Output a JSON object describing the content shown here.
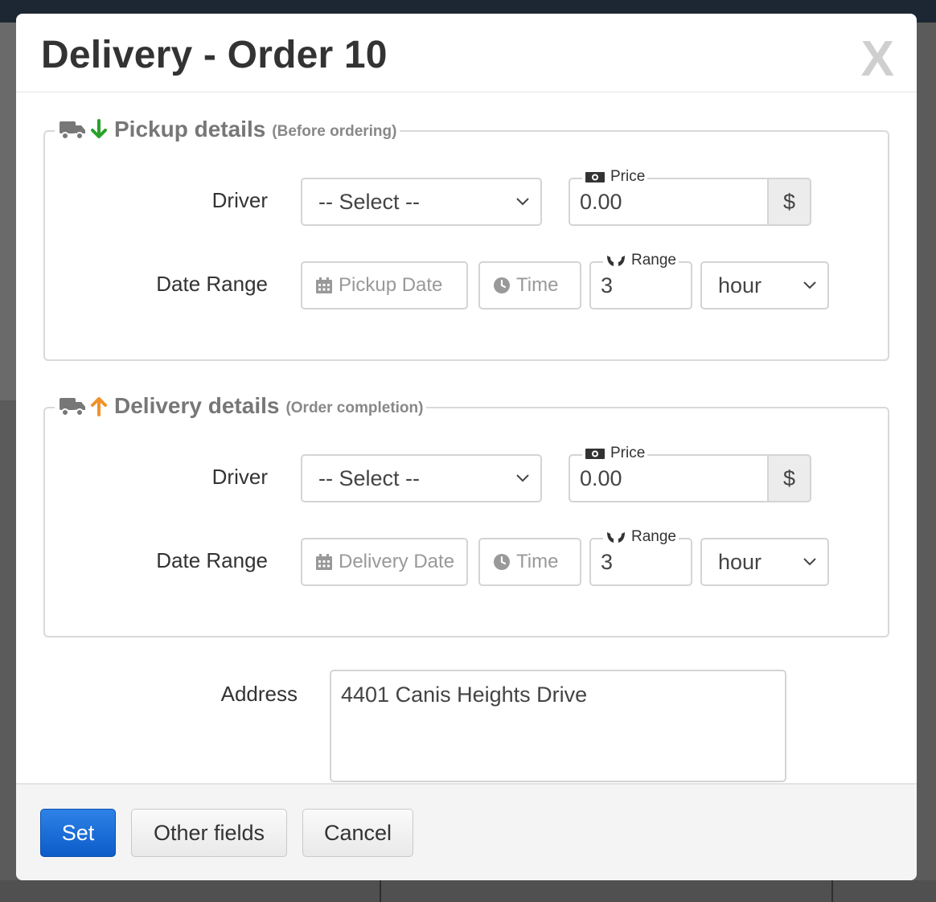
{
  "modal": {
    "title": "Delivery - Order 10",
    "close_label": "X"
  },
  "pickup": {
    "title": "Pickup details",
    "subtitle": "(Before ordering)",
    "driver_label": "Driver",
    "driver_select": "-- Select --",
    "price_label": "Price",
    "price_value": "0.00",
    "currency": "$",
    "date_range_label": "Date Range",
    "date_placeholder": "Pickup Date",
    "time_placeholder": "Time",
    "range_label": "Range",
    "range_value": "3",
    "unit_select": "hour",
    "arrow_color": "#2aa22a"
  },
  "delivery": {
    "title": "Delivery details",
    "subtitle": "(Order completion)",
    "driver_label": "Driver",
    "driver_select": "-- Select --",
    "price_label": "Price",
    "price_value": "0.00",
    "currency": "$",
    "date_range_label": "Date Range",
    "date_placeholder": "Delivery Date",
    "time_placeholder": "Time",
    "range_label": "Range",
    "range_value": "3",
    "unit_select": "hour",
    "arrow_color": "#f0922b"
  },
  "address": {
    "label": "Address",
    "value": "4401 Canis Heights Drive"
  },
  "footer": {
    "set_label": "Set",
    "other_fields_label": "Other fields",
    "cancel_label": "Cancel",
    "primary_color": "#1f6fdc"
  }
}
